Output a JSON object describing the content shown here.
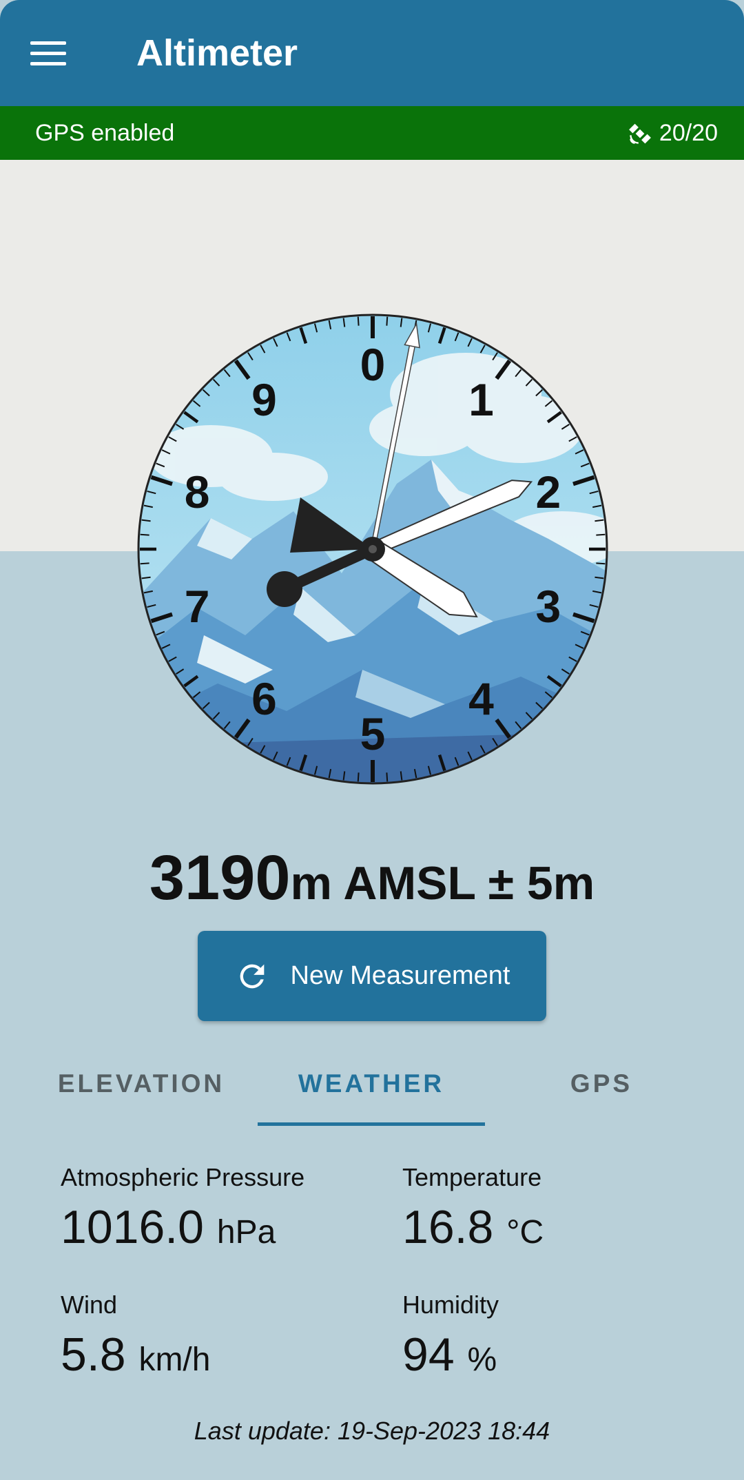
{
  "app_bar": {
    "title": "Altimeter",
    "menu_icon": "hamburger-menu-icon",
    "color": "#22729c"
  },
  "gps_bar": {
    "status": "GPS enabled",
    "satellites": "20/20",
    "satellite_icon": "satellite-icon",
    "color": "#0a730a"
  },
  "gauge": {
    "dial_numbers": [
      "0",
      "1",
      "2",
      "3",
      "4",
      "5",
      "6",
      "7",
      "8",
      "9"
    ]
  },
  "reading": {
    "value": "3190",
    "unit_text": "m AMSL ± 5m"
  },
  "measure_button": {
    "label": "New Measurement",
    "icon": "refresh-icon"
  },
  "tabs": [
    {
      "label": "ELEVATION",
      "active": false
    },
    {
      "label": "WEATHER",
      "active": true
    },
    {
      "label": "GPS",
      "active": false
    }
  ],
  "weather": {
    "pressure": {
      "label": "Atmospheric Pressure",
      "value": "1016.0",
      "unit": "hPa"
    },
    "temperature": {
      "label": "Temperature",
      "value": "16.8",
      "unit": "°C"
    },
    "wind": {
      "label": "Wind",
      "value": "5.8",
      "unit": "km/h"
    },
    "humidity": {
      "label": "Humidity",
      "value": "94",
      "unit": "%"
    }
  },
  "last_update": "Last update: 19-Sep-2023 18:44"
}
